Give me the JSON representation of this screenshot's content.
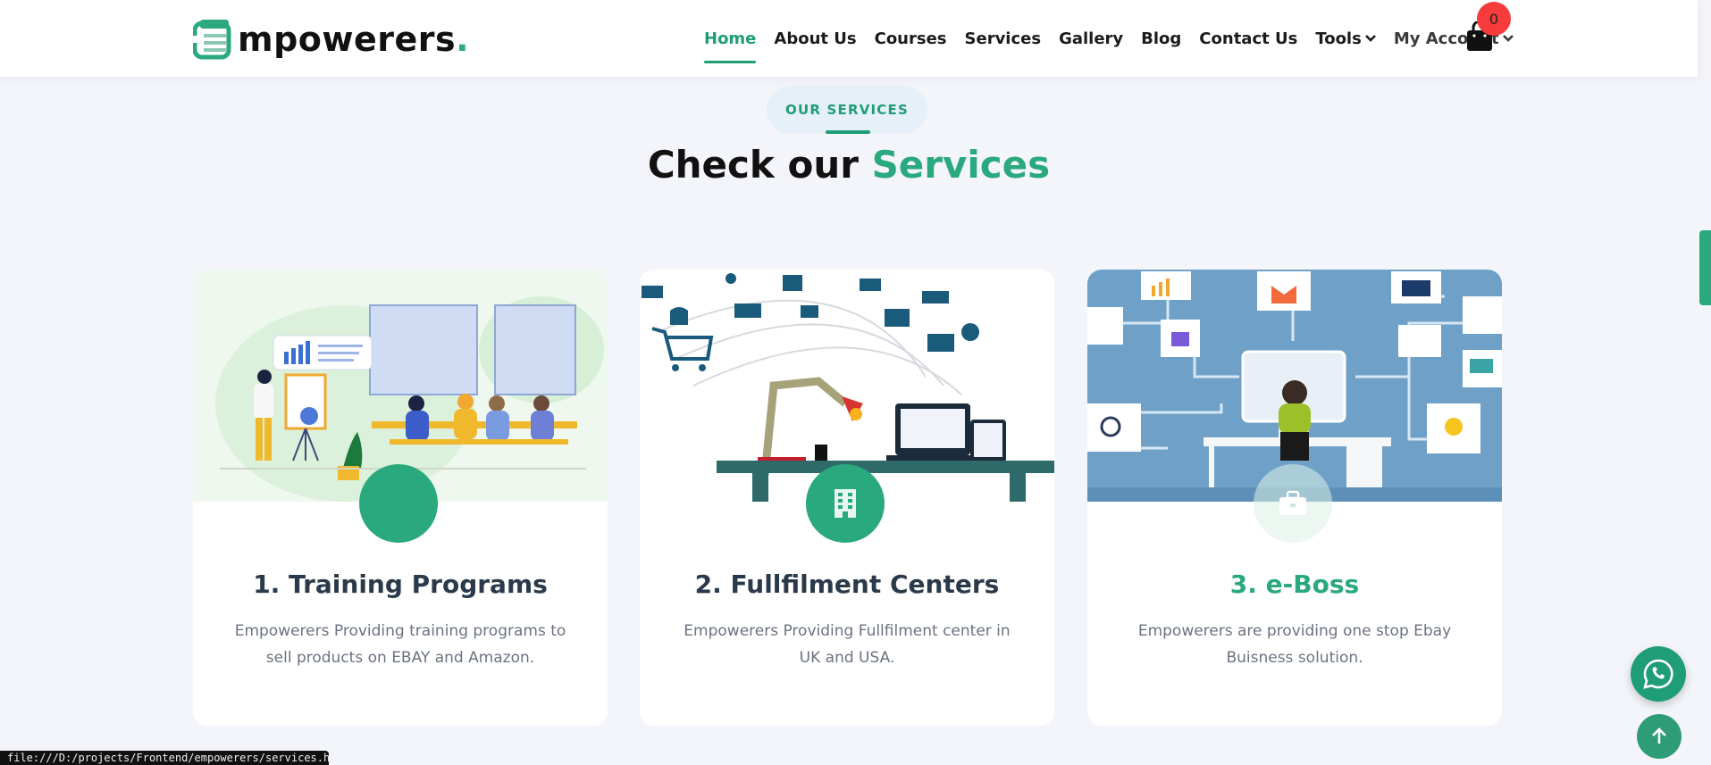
{
  "brand": {
    "logo_text": "mpowerers",
    "logo_dot": ".",
    "accent_color": "#2aa87e"
  },
  "nav": {
    "items": [
      {
        "label": "Home",
        "active": true
      },
      {
        "label": "About Us"
      },
      {
        "label": "Courses"
      },
      {
        "label": "Services"
      },
      {
        "label": "Gallery"
      },
      {
        "label": "Blog"
      },
      {
        "label": "Contact Us"
      },
      {
        "label": "Tools"
      },
      {
        "label": "My Account"
      }
    ],
    "cart_count": "0"
  },
  "section": {
    "eyebrow": "OUR SERVICES",
    "title_main": "Check our ",
    "title_accent": "Services"
  },
  "cards": [
    {
      "title": "1. Training Programs",
      "description": "Empowerers Providing training programs to sell products on EBAY and Amazon.",
      "icon": "circle-icon"
    },
    {
      "title": "2. Fullfilment Centers",
      "description": "Empowerers Providing Fullfilment center in UK and USA.",
      "icon": "building-icon"
    },
    {
      "title": "3. e-Boss",
      "description": "Empowerers are providing one stop Ebay Buisness solution.",
      "icon": "briefcase-icon"
    }
  ],
  "status_url": "file:///D:/projects/Frontend/empowerers/services.html"
}
